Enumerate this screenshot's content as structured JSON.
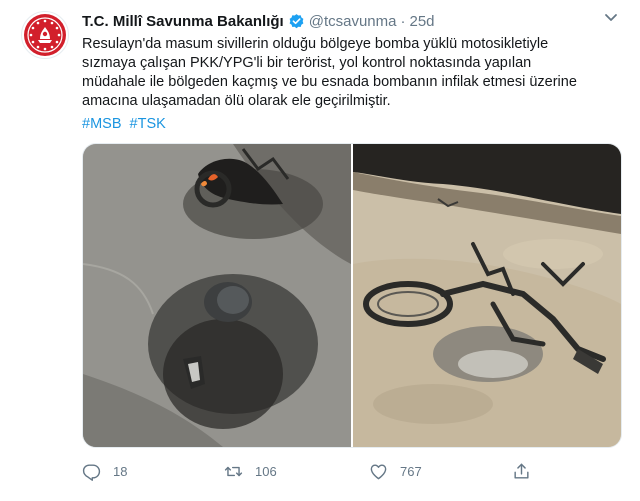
{
  "tweet": {
    "author_name": "T.C. Millî Savunma Bakanlığı",
    "handle": "@tcsavunma",
    "separator": "·",
    "time": "25d",
    "text_lines": [
      "Resulayn'da masum sivillerin olduğu bölgeye bomba yüklü motosikletiyle",
      "sızmaya çalışan PKK/YPG'li bir terörist, yol kontrol noktasında yapılan",
      "müdahale ile bölgeden kaçmış ve bu esnada bombanın infilak etmesi üzerine",
      "amacına ulaşamadan ölü olarak ele geçirilmiştir."
    ],
    "hashtags": [
      "#MSB",
      "#TSK"
    ],
    "actions": {
      "replies": "18",
      "retweets": "106",
      "likes": "767"
    }
  },
  "icons": {
    "avatar": "ministry-emblem-icon",
    "verified": "verified-badge-icon",
    "menu": "chevron-down-icon",
    "reply": "reply-icon",
    "retweet": "retweet-icon",
    "like": "heart-icon",
    "share": "share-icon"
  },
  "colors": {
    "text": "#14171a",
    "muted": "#657786",
    "link": "#1b95e0",
    "verified": "#1da1f2",
    "emblem": "#d21f2b"
  }
}
